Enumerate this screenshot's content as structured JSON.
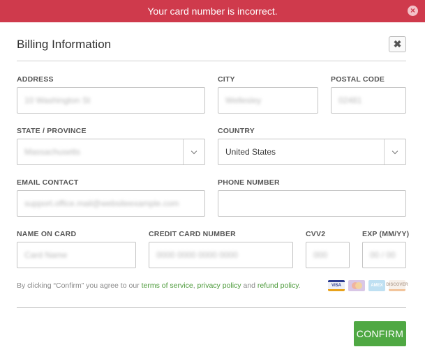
{
  "error": {
    "message": "Your card number is incorrect.",
    "close_glyph": "×",
    "color": "#cf3a4c"
  },
  "dialog": {
    "title": "Billing Information",
    "close_glyph": "✖"
  },
  "fields": {
    "address": {
      "label": "ADDRESS",
      "value": "10 Washington St"
    },
    "city": {
      "label": "CITY",
      "value": "Wellesley"
    },
    "postal_code": {
      "label": "POSTAL CODE",
      "value": "02481"
    },
    "state": {
      "label": "STATE / PROVINCE",
      "value": "Massachusetts"
    },
    "country": {
      "label": "COUNTRY",
      "value": "United States"
    },
    "email": {
      "label": "EMAIL CONTACT",
      "value": "support.office.mail@websiteexample.com"
    },
    "phone": {
      "label": "PHONE NUMBER",
      "value": ""
    },
    "name_on_card": {
      "label": "NAME ON CARD",
      "value": "Card Name"
    },
    "card_number": {
      "label": "CREDIT CARD NUMBER",
      "value": "0000 0000 0000 0000"
    },
    "cvv": {
      "label": "CVV2",
      "value": "000"
    },
    "exp": {
      "label": "EXP (MM/YY)",
      "value": "00 / 00"
    }
  },
  "terms": {
    "prefix": "By clicking “Confirm” you agree to our ",
    "terms_link": "terms of service",
    "sep1": ", ",
    "privacy_link": "privacy policy",
    "sep2": " and ",
    "refund_link": "refund policy",
    "suffix": "."
  },
  "card_icons": [
    "visa-icon",
    "mastercard-icon",
    "amex-icon",
    "discover-icon"
  ],
  "card_icon_text": {
    "visa": "VISA",
    "amex": "AMEX",
    "discover": "DISCOVER"
  },
  "confirm_label": "CONFIRM",
  "accent_color": "#4fa843"
}
